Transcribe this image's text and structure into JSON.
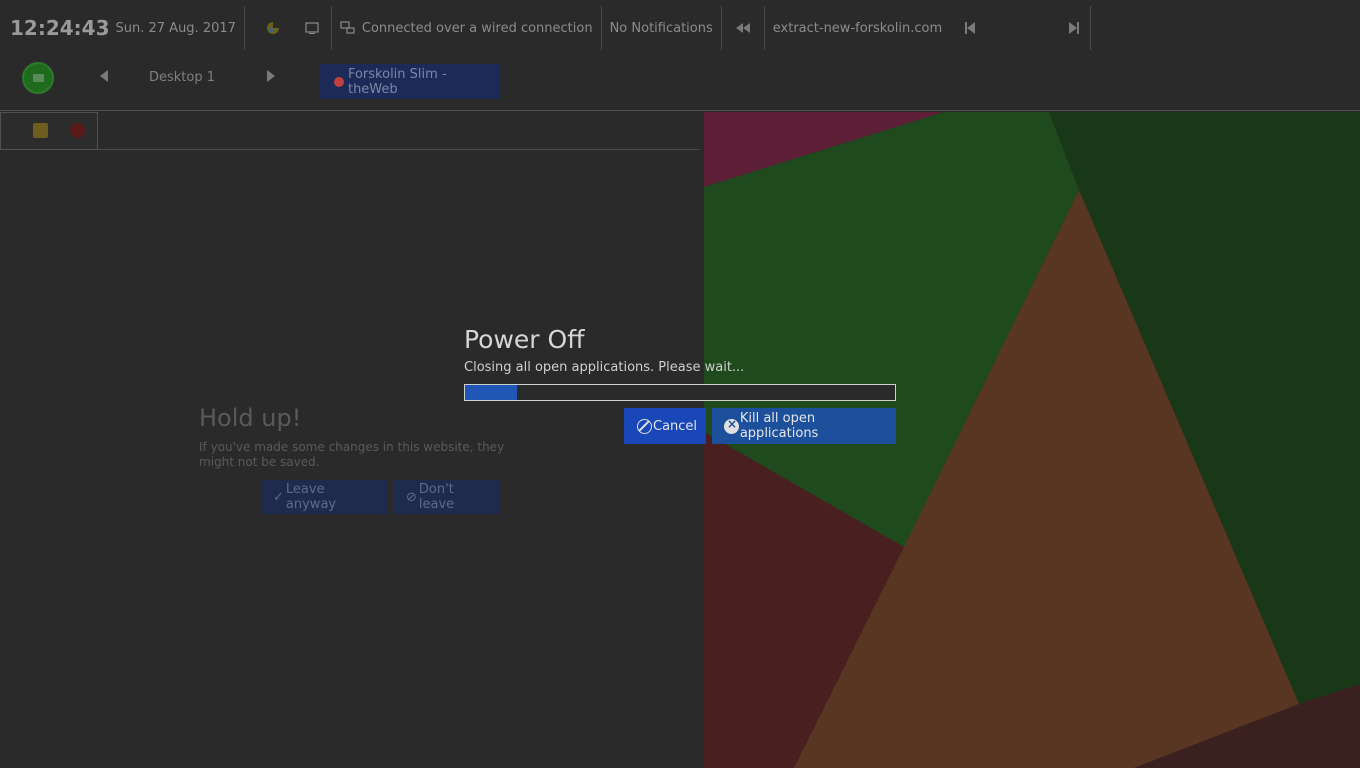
{
  "topbar": {
    "time": "12:24:43",
    "date": "Sun. 27 Aug. 2017",
    "network_status": "Connected over a wired connection",
    "notifications": "No Notifications",
    "media_title": "extract-new-forskolin.com"
  },
  "desktop_bar": {
    "desktop_label": "Desktop 1",
    "task_title": "Forskolin Slim - theWeb"
  },
  "holdup_dialog": {
    "title": "Hold up!",
    "message": "If you've made some changes in this website, they might not be saved.",
    "leave_label": "Leave anyway",
    "stay_label": "Don't leave"
  },
  "poweroff_dialog": {
    "title": "Power Off",
    "message": "Closing all open applications. Please wait...",
    "progress": 0.12,
    "cancel_label": "Cancel",
    "kill_label": "Kill all open applications"
  },
  "colors": {
    "background": "#2a2a2a",
    "accent_blue": "#1a47b8",
    "progress_fill": "#2157b4"
  }
}
